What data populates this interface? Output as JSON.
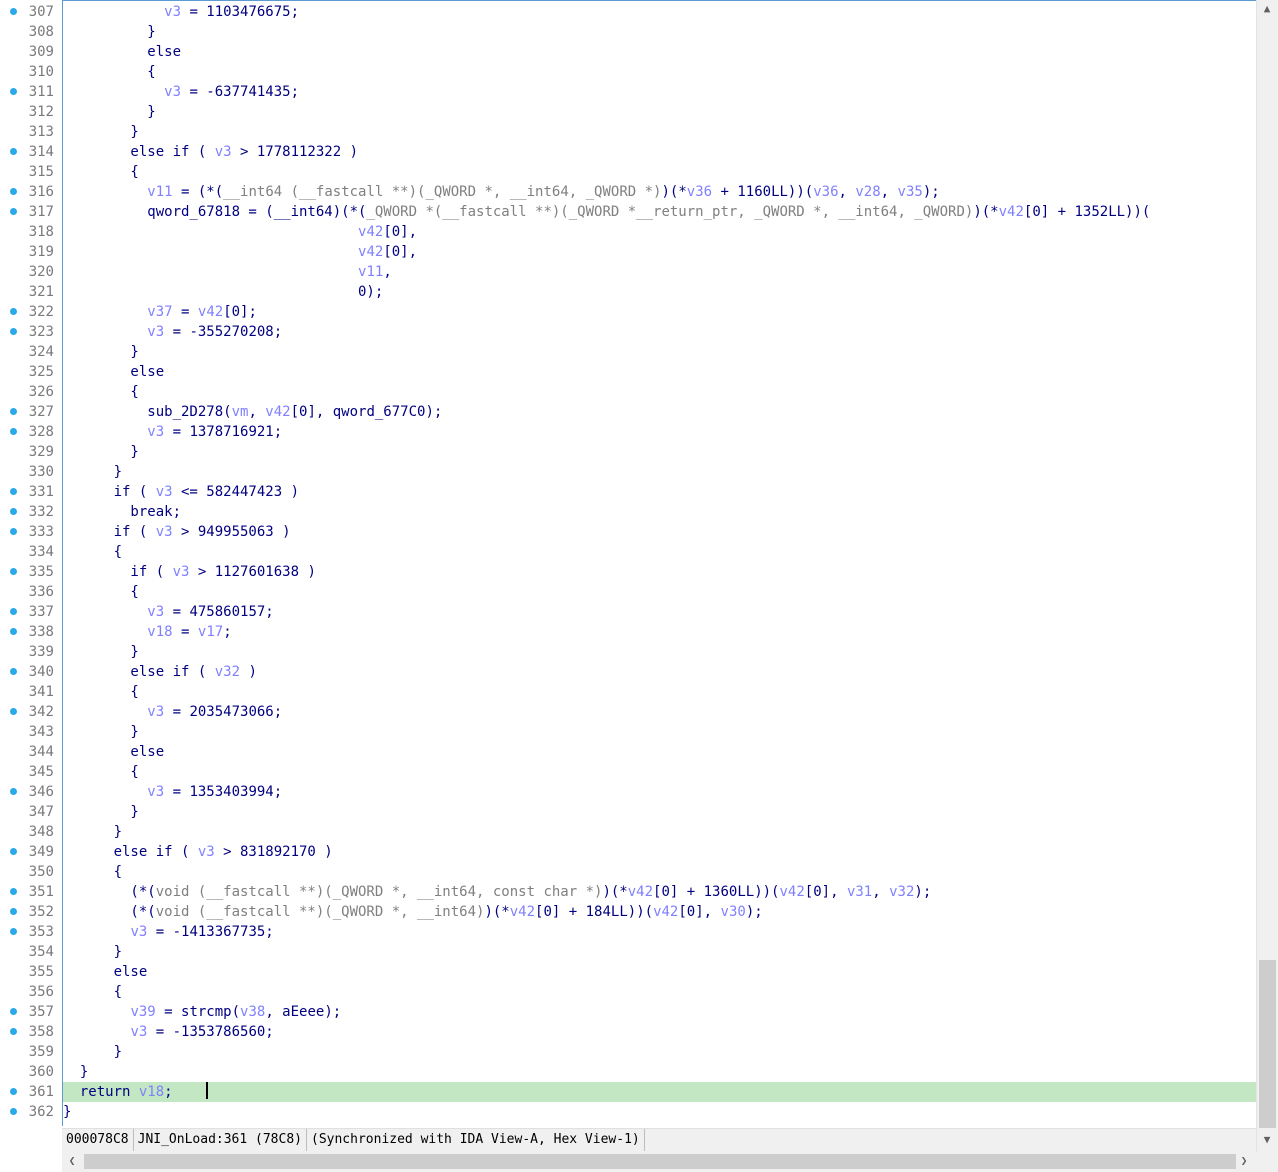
{
  "editor": {
    "current_line": 361,
    "lines": [
      {
        "n": "307",
        "bp": true,
        "t": [
          [
            "            ",
            "d"
          ],
          [
            "v3",
            "v"
          ],
          [
            " = 1103476675;",
            "d"
          ]
        ]
      },
      {
        "n": "308",
        "bp": false,
        "t": [
          [
            "          }",
            "d"
          ]
        ]
      },
      {
        "n": "309",
        "bp": false,
        "t": [
          [
            "          else",
            "d"
          ]
        ]
      },
      {
        "n": "310",
        "bp": false,
        "t": [
          [
            "          {",
            "d"
          ]
        ]
      },
      {
        "n": "311",
        "bp": true,
        "t": [
          [
            "            ",
            "d"
          ],
          [
            "v3",
            "v"
          ],
          [
            " = -637741435;",
            "d"
          ]
        ]
      },
      {
        "n": "312",
        "bp": false,
        "t": [
          [
            "          }",
            "d"
          ]
        ]
      },
      {
        "n": "313",
        "bp": false,
        "t": [
          [
            "        }",
            "d"
          ]
        ]
      },
      {
        "n": "314",
        "bp": true,
        "t": [
          [
            "        else if ( ",
            "d"
          ],
          [
            "v3",
            "v"
          ],
          [
            " > 1778112322 )",
            "d"
          ]
        ]
      },
      {
        "n": "315",
        "bp": false,
        "t": [
          [
            "        {",
            "d"
          ]
        ]
      },
      {
        "n": "316",
        "bp": true,
        "t": [
          [
            "          ",
            "d"
          ],
          [
            "v11",
            "v"
          ],
          [
            " = (*(",
            "d"
          ],
          [
            "__int64 (__fastcall **)(_QWORD *, __int64, _QWORD *)",
            "g"
          ],
          [
            ")(*",
            "d"
          ],
          [
            "v36",
            "v"
          ],
          [
            " + 1160LL))(",
            "d"
          ],
          [
            "v36",
            "v"
          ],
          [
            ", ",
            "d"
          ],
          [
            "v28",
            "v"
          ],
          [
            ", ",
            "d"
          ],
          [
            "v35",
            "v"
          ],
          [
            ");",
            "d"
          ]
        ]
      },
      {
        "n": "317",
        "bp": true,
        "t": [
          [
            "          qword_67818 = (__int64)(*(",
            "d"
          ],
          [
            "_QWORD *(__fastcall **)(_QWORD *__return_ptr, _QWORD *, __int64, _QWORD)",
            "g"
          ],
          [
            ")(*",
            "d"
          ],
          [
            "v42",
            "v"
          ],
          [
            "[0] + 1352LL))(",
            "d"
          ]
        ]
      },
      {
        "n": "318",
        "bp": false,
        "t": [
          [
            "                                   ",
            "d"
          ],
          [
            "v42",
            "v"
          ],
          [
            "[0],",
            "d"
          ]
        ]
      },
      {
        "n": "319",
        "bp": false,
        "t": [
          [
            "                                   ",
            "d"
          ],
          [
            "v42",
            "v"
          ],
          [
            "[0],",
            "d"
          ]
        ]
      },
      {
        "n": "320",
        "bp": false,
        "t": [
          [
            "                                   ",
            "d"
          ],
          [
            "v11",
            "v"
          ],
          [
            ",",
            "d"
          ]
        ]
      },
      {
        "n": "321",
        "bp": false,
        "t": [
          [
            "                                   0);",
            "d"
          ]
        ]
      },
      {
        "n": "322",
        "bp": true,
        "t": [
          [
            "          ",
            "d"
          ],
          [
            "v37",
            "v"
          ],
          [
            " = ",
            "d"
          ],
          [
            "v42",
            "v"
          ],
          [
            "[0];",
            "d"
          ]
        ]
      },
      {
        "n": "323",
        "bp": true,
        "t": [
          [
            "          ",
            "d"
          ],
          [
            "v3",
            "v"
          ],
          [
            " = -355270208;",
            "d"
          ]
        ]
      },
      {
        "n": "324",
        "bp": false,
        "t": [
          [
            "        }",
            "d"
          ]
        ]
      },
      {
        "n": "325",
        "bp": false,
        "t": [
          [
            "        else",
            "d"
          ]
        ]
      },
      {
        "n": "326",
        "bp": false,
        "t": [
          [
            "        {",
            "d"
          ]
        ]
      },
      {
        "n": "327",
        "bp": true,
        "t": [
          [
            "          sub_2D278(",
            "d"
          ],
          [
            "vm",
            "v"
          ],
          [
            ", ",
            "d"
          ],
          [
            "v42",
            "v"
          ],
          [
            "[0], qword_677C0);",
            "d"
          ]
        ]
      },
      {
        "n": "328",
        "bp": true,
        "t": [
          [
            "          ",
            "d"
          ],
          [
            "v3",
            "v"
          ],
          [
            " = 1378716921;",
            "d"
          ]
        ]
      },
      {
        "n": "329",
        "bp": false,
        "t": [
          [
            "        }",
            "d"
          ]
        ]
      },
      {
        "n": "330",
        "bp": false,
        "t": [
          [
            "      }",
            "d"
          ]
        ]
      },
      {
        "n": "331",
        "bp": true,
        "t": [
          [
            "      if ( ",
            "d"
          ],
          [
            "v3",
            "v"
          ],
          [
            " <= 582447423 )",
            "d"
          ]
        ]
      },
      {
        "n": "332",
        "bp": true,
        "t": [
          [
            "        break;",
            "d"
          ]
        ]
      },
      {
        "n": "333",
        "bp": true,
        "t": [
          [
            "      if ( ",
            "d"
          ],
          [
            "v3",
            "v"
          ],
          [
            " > 949955063 )",
            "d"
          ]
        ]
      },
      {
        "n": "334",
        "bp": false,
        "t": [
          [
            "      {",
            "d"
          ]
        ]
      },
      {
        "n": "335",
        "bp": true,
        "t": [
          [
            "        if ( ",
            "d"
          ],
          [
            "v3",
            "v"
          ],
          [
            " > 1127601638 )",
            "d"
          ]
        ]
      },
      {
        "n": "336",
        "bp": false,
        "t": [
          [
            "        {",
            "d"
          ]
        ]
      },
      {
        "n": "337",
        "bp": true,
        "t": [
          [
            "          ",
            "d"
          ],
          [
            "v3",
            "v"
          ],
          [
            " = 475860157;",
            "d"
          ]
        ]
      },
      {
        "n": "338",
        "bp": true,
        "t": [
          [
            "          ",
            "d"
          ],
          [
            "v18",
            "v"
          ],
          [
            " = ",
            "d"
          ],
          [
            "v17",
            "v"
          ],
          [
            ";",
            "d"
          ]
        ]
      },
      {
        "n": "339",
        "bp": false,
        "t": [
          [
            "        }",
            "d"
          ]
        ]
      },
      {
        "n": "340",
        "bp": true,
        "t": [
          [
            "        else if ( ",
            "d"
          ],
          [
            "v32",
            "v"
          ],
          [
            " )",
            "d"
          ]
        ]
      },
      {
        "n": "341",
        "bp": false,
        "t": [
          [
            "        {",
            "d"
          ]
        ]
      },
      {
        "n": "342",
        "bp": true,
        "t": [
          [
            "          ",
            "d"
          ],
          [
            "v3",
            "v"
          ],
          [
            " = 2035473066;",
            "d"
          ]
        ]
      },
      {
        "n": "343",
        "bp": false,
        "t": [
          [
            "        }",
            "d"
          ]
        ]
      },
      {
        "n": "344",
        "bp": false,
        "t": [
          [
            "        else",
            "d"
          ]
        ]
      },
      {
        "n": "345",
        "bp": false,
        "t": [
          [
            "        {",
            "d"
          ]
        ]
      },
      {
        "n": "346",
        "bp": true,
        "t": [
          [
            "          ",
            "d"
          ],
          [
            "v3",
            "v"
          ],
          [
            " = 1353403994;",
            "d"
          ]
        ]
      },
      {
        "n": "347",
        "bp": false,
        "t": [
          [
            "        }",
            "d"
          ]
        ]
      },
      {
        "n": "348",
        "bp": false,
        "t": [
          [
            "      }",
            "d"
          ]
        ]
      },
      {
        "n": "349",
        "bp": true,
        "t": [
          [
            "      else if ( ",
            "d"
          ],
          [
            "v3",
            "v"
          ],
          [
            " > 831892170 )",
            "d"
          ]
        ]
      },
      {
        "n": "350",
        "bp": false,
        "t": [
          [
            "      {",
            "d"
          ]
        ]
      },
      {
        "n": "351",
        "bp": true,
        "t": [
          [
            "        (*(",
            "d"
          ],
          [
            "void (__fastcall **)(_QWORD *, __int64, const char *)",
            "g"
          ],
          [
            ")(*",
            "d"
          ],
          [
            "v42",
            "v"
          ],
          [
            "[0] + 1360LL))(",
            "d"
          ],
          [
            "v42",
            "v"
          ],
          [
            "[0], ",
            "d"
          ],
          [
            "v31",
            "v"
          ],
          [
            ", ",
            "d"
          ],
          [
            "v32",
            "v"
          ],
          [
            ");",
            "d"
          ]
        ]
      },
      {
        "n": "352",
        "bp": true,
        "t": [
          [
            "        (*(",
            "d"
          ],
          [
            "void (__fastcall **)(_QWORD *, __int64)",
            "g"
          ],
          [
            ")(*",
            "d"
          ],
          [
            "v42",
            "v"
          ],
          [
            "[0] + 184LL))(",
            "d"
          ],
          [
            "v42",
            "v"
          ],
          [
            "[0], ",
            "d"
          ],
          [
            "v30",
            "v"
          ],
          [
            ");",
            "d"
          ]
        ]
      },
      {
        "n": "353",
        "bp": true,
        "t": [
          [
            "        ",
            "d"
          ],
          [
            "v3",
            "v"
          ],
          [
            " = -1413367735;",
            "d"
          ]
        ]
      },
      {
        "n": "354",
        "bp": false,
        "t": [
          [
            "      }",
            "d"
          ]
        ]
      },
      {
        "n": "355",
        "bp": false,
        "t": [
          [
            "      else",
            "d"
          ]
        ]
      },
      {
        "n": "356",
        "bp": false,
        "t": [
          [
            "      {",
            "d"
          ]
        ]
      },
      {
        "n": "357",
        "bp": true,
        "t": [
          [
            "        ",
            "d"
          ],
          [
            "v39",
            "v"
          ],
          [
            " = strcmp(",
            "d"
          ],
          [
            "v38",
            "v"
          ],
          [
            ", aEeee);",
            "d"
          ]
        ]
      },
      {
        "n": "358",
        "bp": true,
        "t": [
          [
            "        ",
            "d"
          ],
          [
            "v3",
            "v"
          ],
          [
            " = -1353786560;",
            "d"
          ]
        ]
      },
      {
        "n": "359",
        "bp": false,
        "t": [
          [
            "      }",
            "d"
          ]
        ]
      },
      {
        "n": "360",
        "bp": false,
        "t": [
          [
            "  }",
            "d"
          ]
        ]
      },
      {
        "n": "361",
        "bp": true,
        "t": [
          [
            "  return ",
            "d"
          ],
          [
            "v18",
            "v"
          ],
          [
            ";    ",
            "d"
          ]
        ]
      },
      {
        "n": "362",
        "bp": true,
        "t": [
          [
            "}",
            "d"
          ]
        ]
      }
    ]
  },
  "status": {
    "address": "000078C8",
    "location": "JNI_OnLoad:361 (78C8)",
    "sync": "(Synchronized with IDA View-A, Hex View-1)"
  },
  "scroll": {
    "up_arrow": "▲",
    "down_arrow": "▼",
    "left_arrow": "❮",
    "right_arrow": "❯"
  },
  "colors": {
    "text": "#000080",
    "variable": "#8080ff",
    "type_cast": "#808080",
    "breakpoint_dot": "#29a9e8",
    "current_line_bg": "#c3e6c3",
    "line_number": "#7a7a7a"
  }
}
